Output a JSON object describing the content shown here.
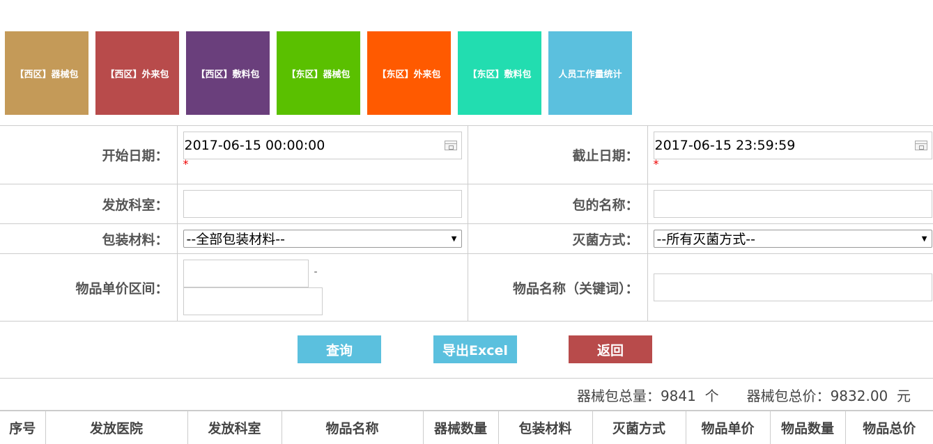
{
  "tiles": [
    {
      "label": "【西区】器械包",
      "color": "#c49a58"
    },
    {
      "label": "【西区】外来包",
      "color": "#b84b4b"
    },
    {
      "label": "【西区】敷料包",
      "color": "#6a3f7c"
    },
    {
      "label": "【东区】器械包",
      "color": "#5ac000"
    },
    {
      "label": "【东区】外来包",
      "color": "#ff5a00"
    },
    {
      "label": "【东区】敷料包",
      "color": "#22ddb0"
    },
    {
      "label": "人员工作量统计",
      "color": "#5bc0de"
    }
  ],
  "form": {
    "start_label": "开始日期：",
    "start_value": "2017-06-15 00:00:00",
    "end_label": "截止日期：",
    "end_value": "2017-06-15 23:59:59",
    "required_mark": "*",
    "dept_label": "发放科室：",
    "pkg_name_label": "包的名称：",
    "material_label": "包装材料：",
    "material_value": "--全部包装材料--",
    "sterilize_label": "灭菌方式：",
    "sterilize_value": "--所有灭菌方式--",
    "price_range_label": "物品单价区间：",
    "range_dash": "-",
    "keyword_label": "物品名称（关键词）："
  },
  "buttons": {
    "query": "查询",
    "export": "导出Excel",
    "back": "返回"
  },
  "colors": {
    "query": "#5bc0de",
    "export": "#5bc0de",
    "back": "#b84b4b"
  },
  "summary": {
    "total_qty_label": "器械包总量：",
    "total_qty_value": "9841",
    "total_qty_unit": "个",
    "total_price_label": "器械包总价：",
    "total_price_value": "9832.00",
    "total_price_unit": "元"
  },
  "table": {
    "headers": [
      "序号",
      "发放医院",
      "发放科室",
      "物品名称",
      "器械数量",
      "包装材料",
      "灭菌方式",
      "物品单价",
      "物品数量",
      "物品总价"
    ]
  }
}
